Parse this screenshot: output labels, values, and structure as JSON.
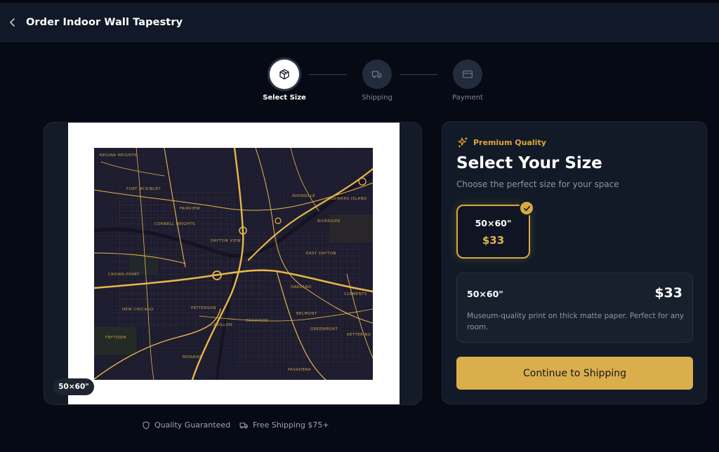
{
  "header": {
    "title": "Order Indoor Wall Tapestry"
  },
  "steps": [
    {
      "label": "Select Size",
      "icon": "package-icon"
    },
    {
      "label": "Shipping",
      "icon": "truck-icon"
    },
    {
      "label": "Payment",
      "icon": "credit-card-icon"
    }
  ],
  "preview": {
    "size_badge": "50×60\"",
    "map_labels": {
      "a": "REGINA HEIGHTS",
      "b": "FORT MCKINLEY",
      "c": "FAIRVIEW",
      "d": "CORNELL HEIGHTS",
      "e": "DAYTON VIEW",
      "f": "CROWN POINT",
      "g": "NEW CHICAGO",
      "h": "FRYTOWN",
      "i": "AVONDALE",
      "j": "ROHRERS ISLAND",
      "k": "RIVERSIDE",
      "l": "EAST DAYTON",
      "m": "OAKLAND",
      "n": "BELMONT",
      "o": "GREENMONT",
      "p": "CARILLON",
      "q": "OAKWOOD",
      "r": "MORAINE",
      "s": "PASADENA",
      "t": "PATTERSON",
      "u": "CLEMENTS",
      "v": "KETTERING"
    }
  },
  "trust": {
    "quality": "Quality Guaranteed",
    "shipping": "Free Shipping $75+"
  },
  "panel": {
    "premium_label": "Premium Quality",
    "title": "Select Your Size",
    "subtitle": "Choose the perfect size for your space",
    "option": {
      "size": "50×60\"",
      "price": "$33",
      "selected": true
    },
    "detail": {
      "size": "50×60\"",
      "price": "$33",
      "description": "Museum-quality print on thick matte paper. Perfect for any room."
    },
    "continue_label": "Continue to Shipping"
  },
  "colors": {
    "accent": "#dbae4c",
    "background": "#060a14",
    "panel": "#121a28",
    "map_road": "#e6b84a"
  }
}
